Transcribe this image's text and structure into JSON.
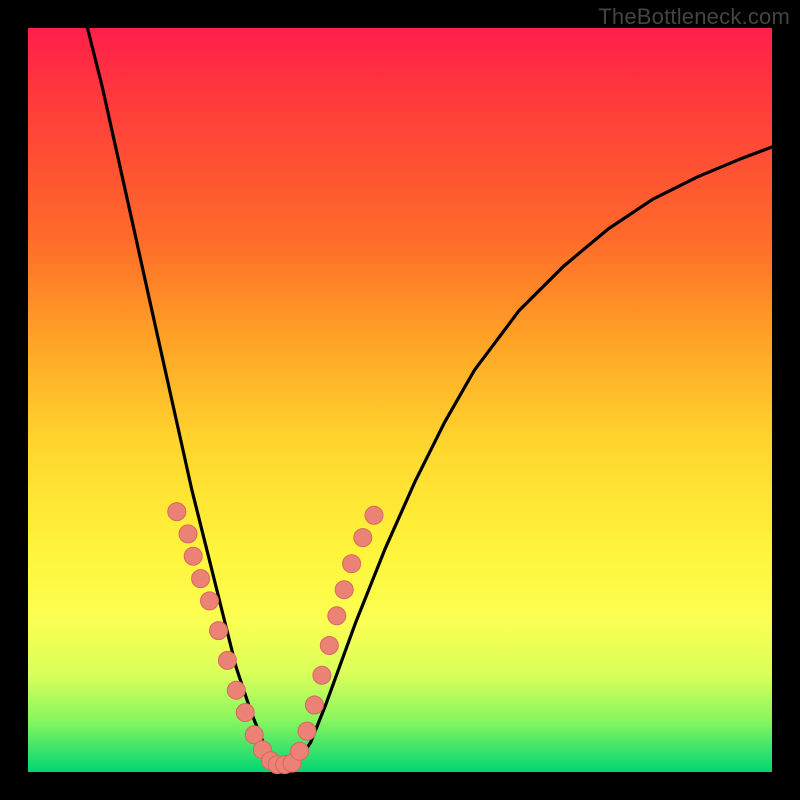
{
  "watermark": "TheBottleneck.com",
  "colors": {
    "frame": "#000000",
    "curve": "#000000",
    "dot_fill": "#ec8276",
    "dot_stroke": "#d46a5e"
  },
  "chart_data": {
    "type": "line",
    "title": "",
    "xlabel": "",
    "ylabel": "",
    "xlim": [
      0,
      100
    ],
    "ylim": [
      0,
      100
    ],
    "series": [
      {
        "name": "bottleneck-curve",
        "x": [
          8,
          10,
          12,
          14,
          16,
          18,
          20,
          22,
          24,
          26,
          28,
          30,
          32,
          34,
          36,
          38,
          40,
          44,
          48,
          52,
          56,
          60,
          66,
          72,
          78,
          84,
          90,
          96,
          100
        ],
        "values": [
          100,
          92,
          83,
          74,
          65,
          56,
          47,
          38,
          30,
          22,
          14,
          8,
          3,
          1,
          1,
          4,
          9,
          20,
          30,
          39,
          47,
          54,
          62,
          68,
          73,
          77,
          80,
          82.5,
          84
        ]
      }
    ],
    "highlight_points": {
      "name": "marked-region",
      "x": [
        20,
        21.5,
        22.2,
        23.2,
        24.4,
        25.6,
        26.8,
        28,
        29.2,
        30.4,
        31.5,
        32.6,
        33.5,
        34.5,
        35.5,
        36.5,
        37.5,
        38.5,
        39.5,
        40.5,
        41.5,
        42.5,
        43.5,
        45,
        46.5
      ],
      "values": [
        35,
        32,
        29,
        26,
        23,
        19,
        15,
        11,
        8,
        5,
        3,
        1.5,
        1,
        1,
        1.2,
        2.8,
        5.5,
        9,
        13,
        17,
        21,
        24.5,
        28,
        31.5,
        34.5
      ]
    }
  }
}
